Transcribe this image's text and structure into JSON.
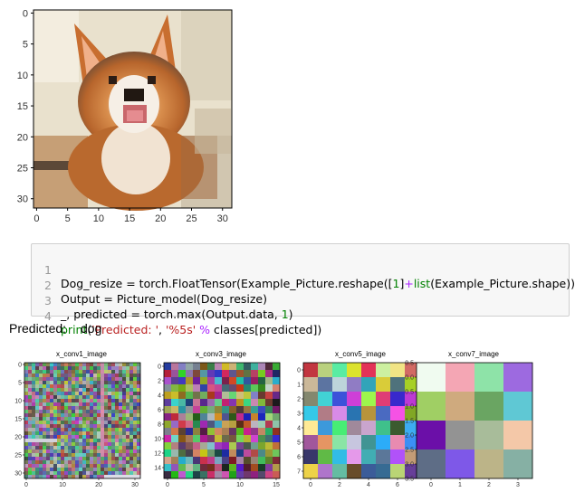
{
  "main_image": {
    "y_ticks": [
      "0",
      "5",
      "10",
      "15",
      "20",
      "25",
      "30"
    ],
    "x_ticks": [
      "0",
      "5",
      "10",
      "15",
      "20",
      "25",
      "30"
    ]
  },
  "code_cell": {
    "lines": [
      {
        "num": "1",
        "text": "Dog_resize = torch.FloatTensor(Example_Picture.reshape([1]+list(Example_Picture.shape)))"
      },
      {
        "num": "2",
        "text": "Output = Picture_model(Dog_resize)"
      },
      {
        "num": "3",
        "text": "_, predicted = torch.max(Output.data, 1)"
      },
      {
        "num": "4",
        "text": "print('Predicted: ', '%5s' % classes[predicted])"
      }
    ]
  },
  "output": {
    "label": "Predicted:",
    "value": "dog"
  },
  "subplots": [
    {
      "title": "x_conv1_image",
      "y_ticks": [
        "0",
        "5",
        "10",
        "15",
        "20",
        "25",
        "30"
      ],
      "x_ticks": [
        "0",
        "10",
        "20",
        "30"
      ]
    },
    {
      "title": "x_conv3_image",
      "y_ticks": [
        "0",
        "2",
        "4",
        "6",
        "8",
        "10",
        "12",
        "14"
      ],
      "x_ticks": [
        "0",
        "5",
        "10",
        "15"
      ]
    },
    {
      "title": "x_conv5_image",
      "y_ticks": [
        "0",
        "1",
        "2",
        "3",
        "4",
        "5",
        "6",
        "7"
      ],
      "x_ticks": [
        "0",
        "2",
        "4",
        "6"
      ]
    },
    {
      "title": "x_conv7_image",
      "y_ticks": [
        "−0.5",
        "0.0",
        "0.5",
        "1.0",
        "1.5",
        "2.0",
        "2.5",
        "3.0",
        "3.5"
      ],
      "x_ticks": [
        "0",
        "1",
        "2",
        "3"
      ]
    }
  ],
  "colors": {
    "grid4": [
      "#f0fbf0",
      "#f4a6b4",
      "#8ee3a8",
      "#9d6ae0",
      "#a0cf64",
      "#cfaa7e",
      "#6aa562",
      "#5fc8d4",
      "#6b0fa8",
      "#939393",
      "#a8bc9a",
      "#f4c8a8",
      "#5e6d86",
      "#7e58e8",
      "#bcb488",
      "#86b0a4"
    ]
  }
}
